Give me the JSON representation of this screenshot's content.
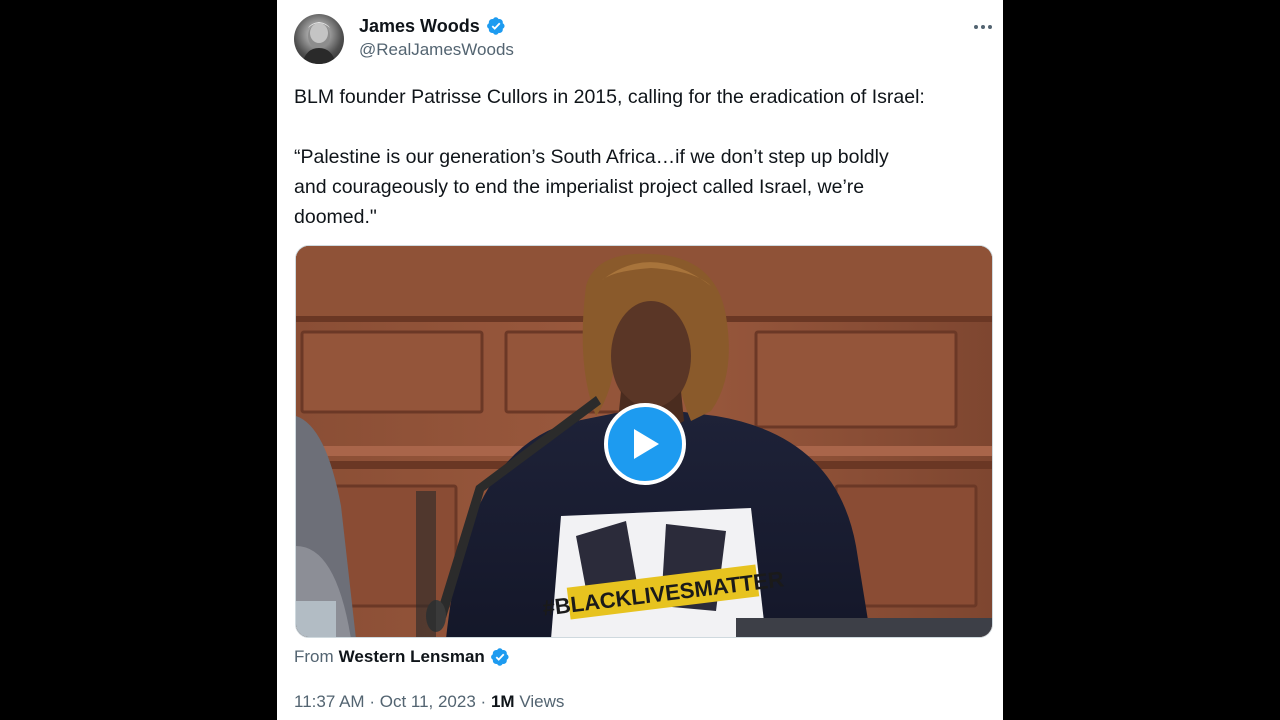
{
  "tweet": {
    "author_name": "James Woods",
    "author_handle": "@RealJamesWoods",
    "text_line1": "BLM founder Patrisse Cullors in 2015, calling for the eradication of Israel:",
    "text_quote": "“Palestine is our generation’s South Africa…if we don’t step up boldly\nand courageously to end the imperialist project called Israel, we’re\ndoomed.\"",
    "media": {
      "type": "video",
      "shirt_text": "#BLACKLIVESMATTER"
    },
    "from_label": "From",
    "from_source": "Western Lensman",
    "time": "11:37 AM",
    "separator": "·",
    "date": "Oct 11, 2023",
    "views_count": "1M",
    "views_label": "Views"
  },
  "colors": {
    "accent": "#1d9bf0",
    "text_primary": "#0f1419",
    "text_secondary": "#536471",
    "background": "#ffffff",
    "letterbox": "#000000"
  },
  "icons": {
    "verified": "verified-badge-icon",
    "more": "more-options-icon",
    "play": "play-icon"
  }
}
